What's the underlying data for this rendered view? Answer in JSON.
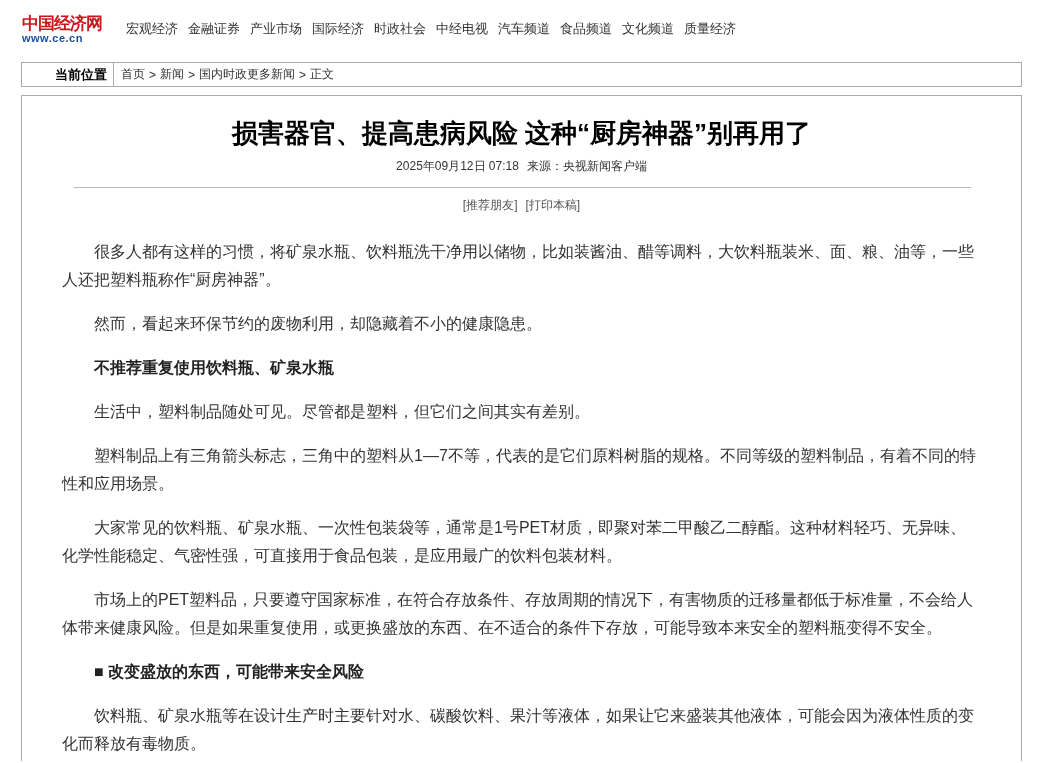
{
  "logo": {
    "name": "中国经济网",
    "url": "www.ce.cn"
  },
  "nav": [
    "宏观经济",
    "金融证券",
    "产业市场",
    "国际经济",
    "时政社会",
    "中经电视",
    "汽车频道",
    "食品频道",
    "文化频道",
    "质量经济"
  ],
  "breadcrumb": {
    "label": "当前位置",
    "items": [
      "首页",
      "新闻",
      "国内时政更多新闻",
      "正文"
    ],
    "separator": ">"
  },
  "article": {
    "title": "损害器官、提高患病风险 这种“厨房神器”别再用了",
    "date": "2025年09月12日 07:18",
    "source": "来源：央视新闻客户端",
    "actions": [
      "[推荐朋友]",
      "[打印本稿]"
    ],
    "paragraphs": [
      {
        "kind": "text",
        "text": "很多人都有这样的习惯，将矿泉水瓶、饮料瓶洗干净用以储物，比如装酱油、醋等调料，大饮料瓶装米、面、粮、油等，一些人还把塑料瓶称作“厨房神器”。"
      },
      {
        "kind": "text",
        "text": "然而，看起来环保节约的废物利用，却隐藏着不小的健康隐患。"
      },
      {
        "kind": "heading",
        "text": "不推荐重复使用饮料瓶、矿泉水瓶"
      },
      {
        "kind": "text",
        "text": "生活中，塑料制品随处可见。尽管都是塑料，但它们之间其实有差别。"
      },
      {
        "kind": "text",
        "text": "塑料制品上有三角箭头标志，三角中的塑料从1—7不等，代表的是它们原料树脂的规格。不同等级的塑料制品，有着不同的特性和应用场景。"
      },
      {
        "kind": "text",
        "text": "大家常见的饮料瓶、矿泉水瓶、一次性包装袋等，通常是1号PET材质，即聚对苯二甲酸乙二醇酯。这种材料轻巧、无异味、化学性能稳定、气密性强，可直接用于食品包装，是应用最广的饮料包装材料。"
      },
      {
        "kind": "text",
        "text": "市场上的PET塑料品，只要遵守国家标准，在符合存放条件、存放周期的情况下，有害物质的迁移量都低于标准量，不会给人体带来健康风险。但是如果重复使用，或更换盛放的东西、在不适合的条件下存放，可能导致本来安全的塑料瓶变得不安全。"
      },
      {
        "kind": "heading",
        "text": "■ 改变盛放的东西，可能带来安全风险"
      },
      {
        "kind": "text",
        "text": "饮料瓶、矿泉水瓶等在设计生产时主要针对水、碳酸饮料、果汁等液体，如果让它来盛装其他液体，可能会因为液体性质的变化而释放有毒物质。"
      }
    ]
  }
}
